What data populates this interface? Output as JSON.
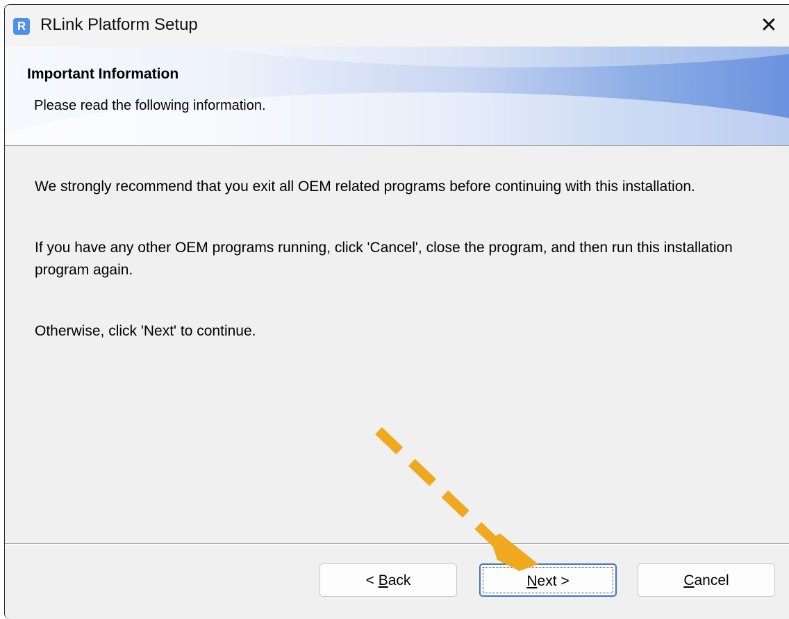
{
  "window": {
    "title": "RLink Platform Setup",
    "icon_letter": "R",
    "close_symbol": "✕"
  },
  "banner": {
    "title": "Important Information",
    "subtitle": "Please read the following information."
  },
  "content": {
    "paragraphs": [
      "We strongly recommend that you exit all OEM related programs before continuing with this installation.",
      "If you have any other OEM programs running, click 'Cancel', close the program, and then run this installation program again.",
      "Otherwise, click 'Next' to continue."
    ]
  },
  "buttons": {
    "back": {
      "prefix": "< ",
      "accel": "B",
      "rest": "ack"
    },
    "next": {
      "accel": "N",
      "rest": "ext >"
    },
    "cancel": {
      "accel": "C",
      "rest": "ancel"
    }
  },
  "annotation": {
    "arrow_color": "#f0a81e",
    "icon": "dashed-arrow-icon"
  },
  "colors": {
    "accent": "#3a75c4",
    "app_icon": "#4d8fe9"
  }
}
